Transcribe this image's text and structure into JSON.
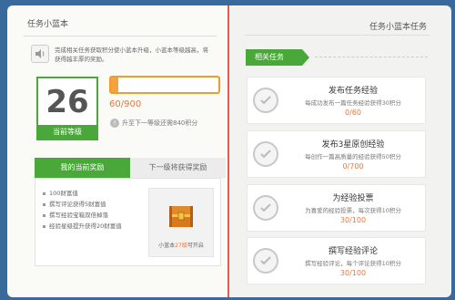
{
  "left": {
    "title": "任务小蓝本",
    "intro": "完成相关任务获取积分使小蓝本升级，小蓝本等级越高，将获得越丰厚的奖励。",
    "level": {
      "number": "26",
      "label": "当前等级"
    },
    "progress": {
      "text": "60/900",
      "fraction": 0.067
    },
    "tip": "升至下一等级还需840积分",
    "tabs": {
      "current": "我的当前奖励",
      "next": "下一级将获得奖励"
    },
    "rewards": [
      "100财富值",
      "撰写评论获得5财富值",
      "撰写经验宝箱双倍掉落",
      "经验星级提升获得20财富值"
    ],
    "chest": {
      "prefix": "小蓝本",
      "level": "27级",
      "suffix": "可开启"
    }
  },
  "right": {
    "title": "任务小蓝本任务",
    "section": "相关任务",
    "tasks": [
      {
        "title": "发布任务经验",
        "desc": "每成功发布一篇任务经验获得30积分",
        "progress": "0/60"
      },
      {
        "title": "发布3星原创经验",
        "desc": "每创作一篇高质量的经验获得50积分",
        "progress": "0/700"
      },
      {
        "title": "为经验投票",
        "desc": "为喜爱的经验投票，每次获得10积分",
        "progress": "30/100"
      },
      {
        "title": "撰写经验评论",
        "desc": "撰写经验评论，每个评论获得10积分",
        "progress": "30/100"
      }
    ]
  },
  "colors": {
    "accent_green": "#4aa83a",
    "accent_orange": "#e8773a",
    "spine_red": "#e65a52",
    "background_blue": "#3a6a9c"
  },
  "icons": [
    "speaker-icon",
    "info-icon",
    "treasure-chest-icon",
    "check-circle-icon"
  ]
}
